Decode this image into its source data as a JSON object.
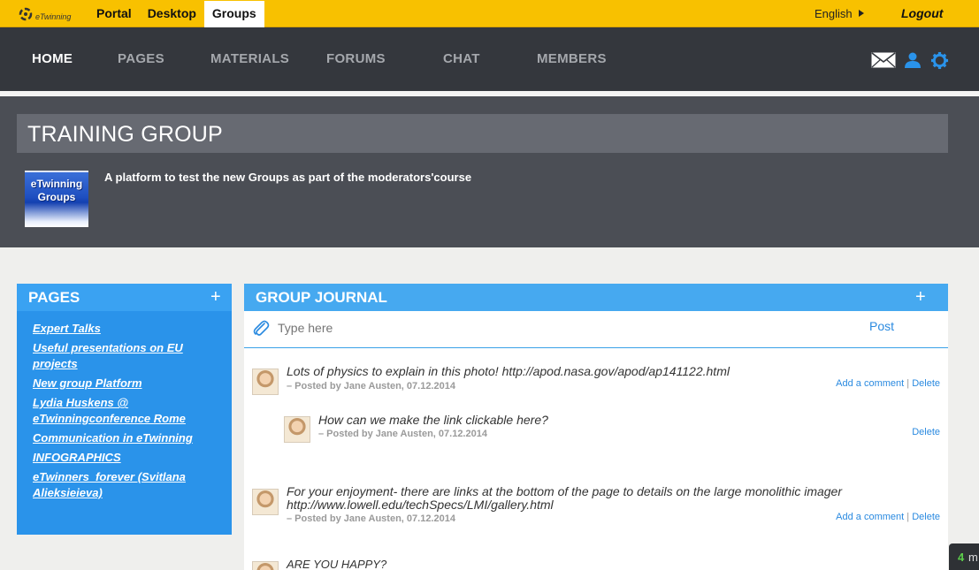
{
  "topbar": {
    "logo_text": "eTwinning",
    "links": [
      "Portal",
      "Desktop",
      "Groups"
    ],
    "active_link": "Groups",
    "language": "English",
    "logout": "Logout"
  },
  "nav": {
    "items": [
      "HOME",
      "PAGES",
      "MATERIALS",
      "FORUMS",
      "CHAT",
      "MEMBERS"
    ],
    "active": "HOME"
  },
  "group": {
    "title": "TRAINING GROUP",
    "thumb_text_1": "eTwinning",
    "thumb_text_2": "Groups",
    "description": "A platform to test the new Groups as part of the moderators'course"
  },
  "pages_panel": {
    "title": "PAGES",
    "plus": "+",
    "items": [
      "Expert Talks",
      "Useful presentations on EU projects",
      "New group Platform",
      "Lydia Huskens @ eTwinningconference Rome",
      "Communication in eTwinning",
      "INFOGRAPHICS",
      "eTwinners_forever (Svitlana Alieksieieva)"
    ]
  },
  "journal": {
    "title": "GROUP JOURNAL",
    "plus": "+",
    "placeholder": "Type here",
    "post_label": "Post",
    "entries": [
      {
        "message": "Lots of physics to explain in this photo! http://apod.nasa.gov/apod/ap141122.html",
        "meta": "– Posted by Jane Austen, 07.12.2014",
        "add_comment": "Add a comment",
        "delete": "Delete"
      },
      {
        "message": "How can we make the link clickable here?",
        "meta": "– Posted by Jane Austen, 07.12.2014",
        "delete": "Delete"
      },
      {
        "message_line1": "For your enjoyment- there are links at the bottom of the page to details on the large monolithic imager",
        "message_line2": "http://www.lowell.edu/techSpecs/LMI/gallery.html",
        "meta": "– Posted by Jane Austen, 07.12.2014",
        "add_comment": "Add a comment",
        "delete": "Delete"
      },
      {
        "message": "ARE YOU HAPPY?"
      }
    ]
  },
  "chat_corner": {
    "count": "4",
    "label": "m"
  },
  "colors": {
    "topbar": "#f8c100",
    "nav": "#34373d",
    "accent_blue": "#2a93ea"
  }
}
